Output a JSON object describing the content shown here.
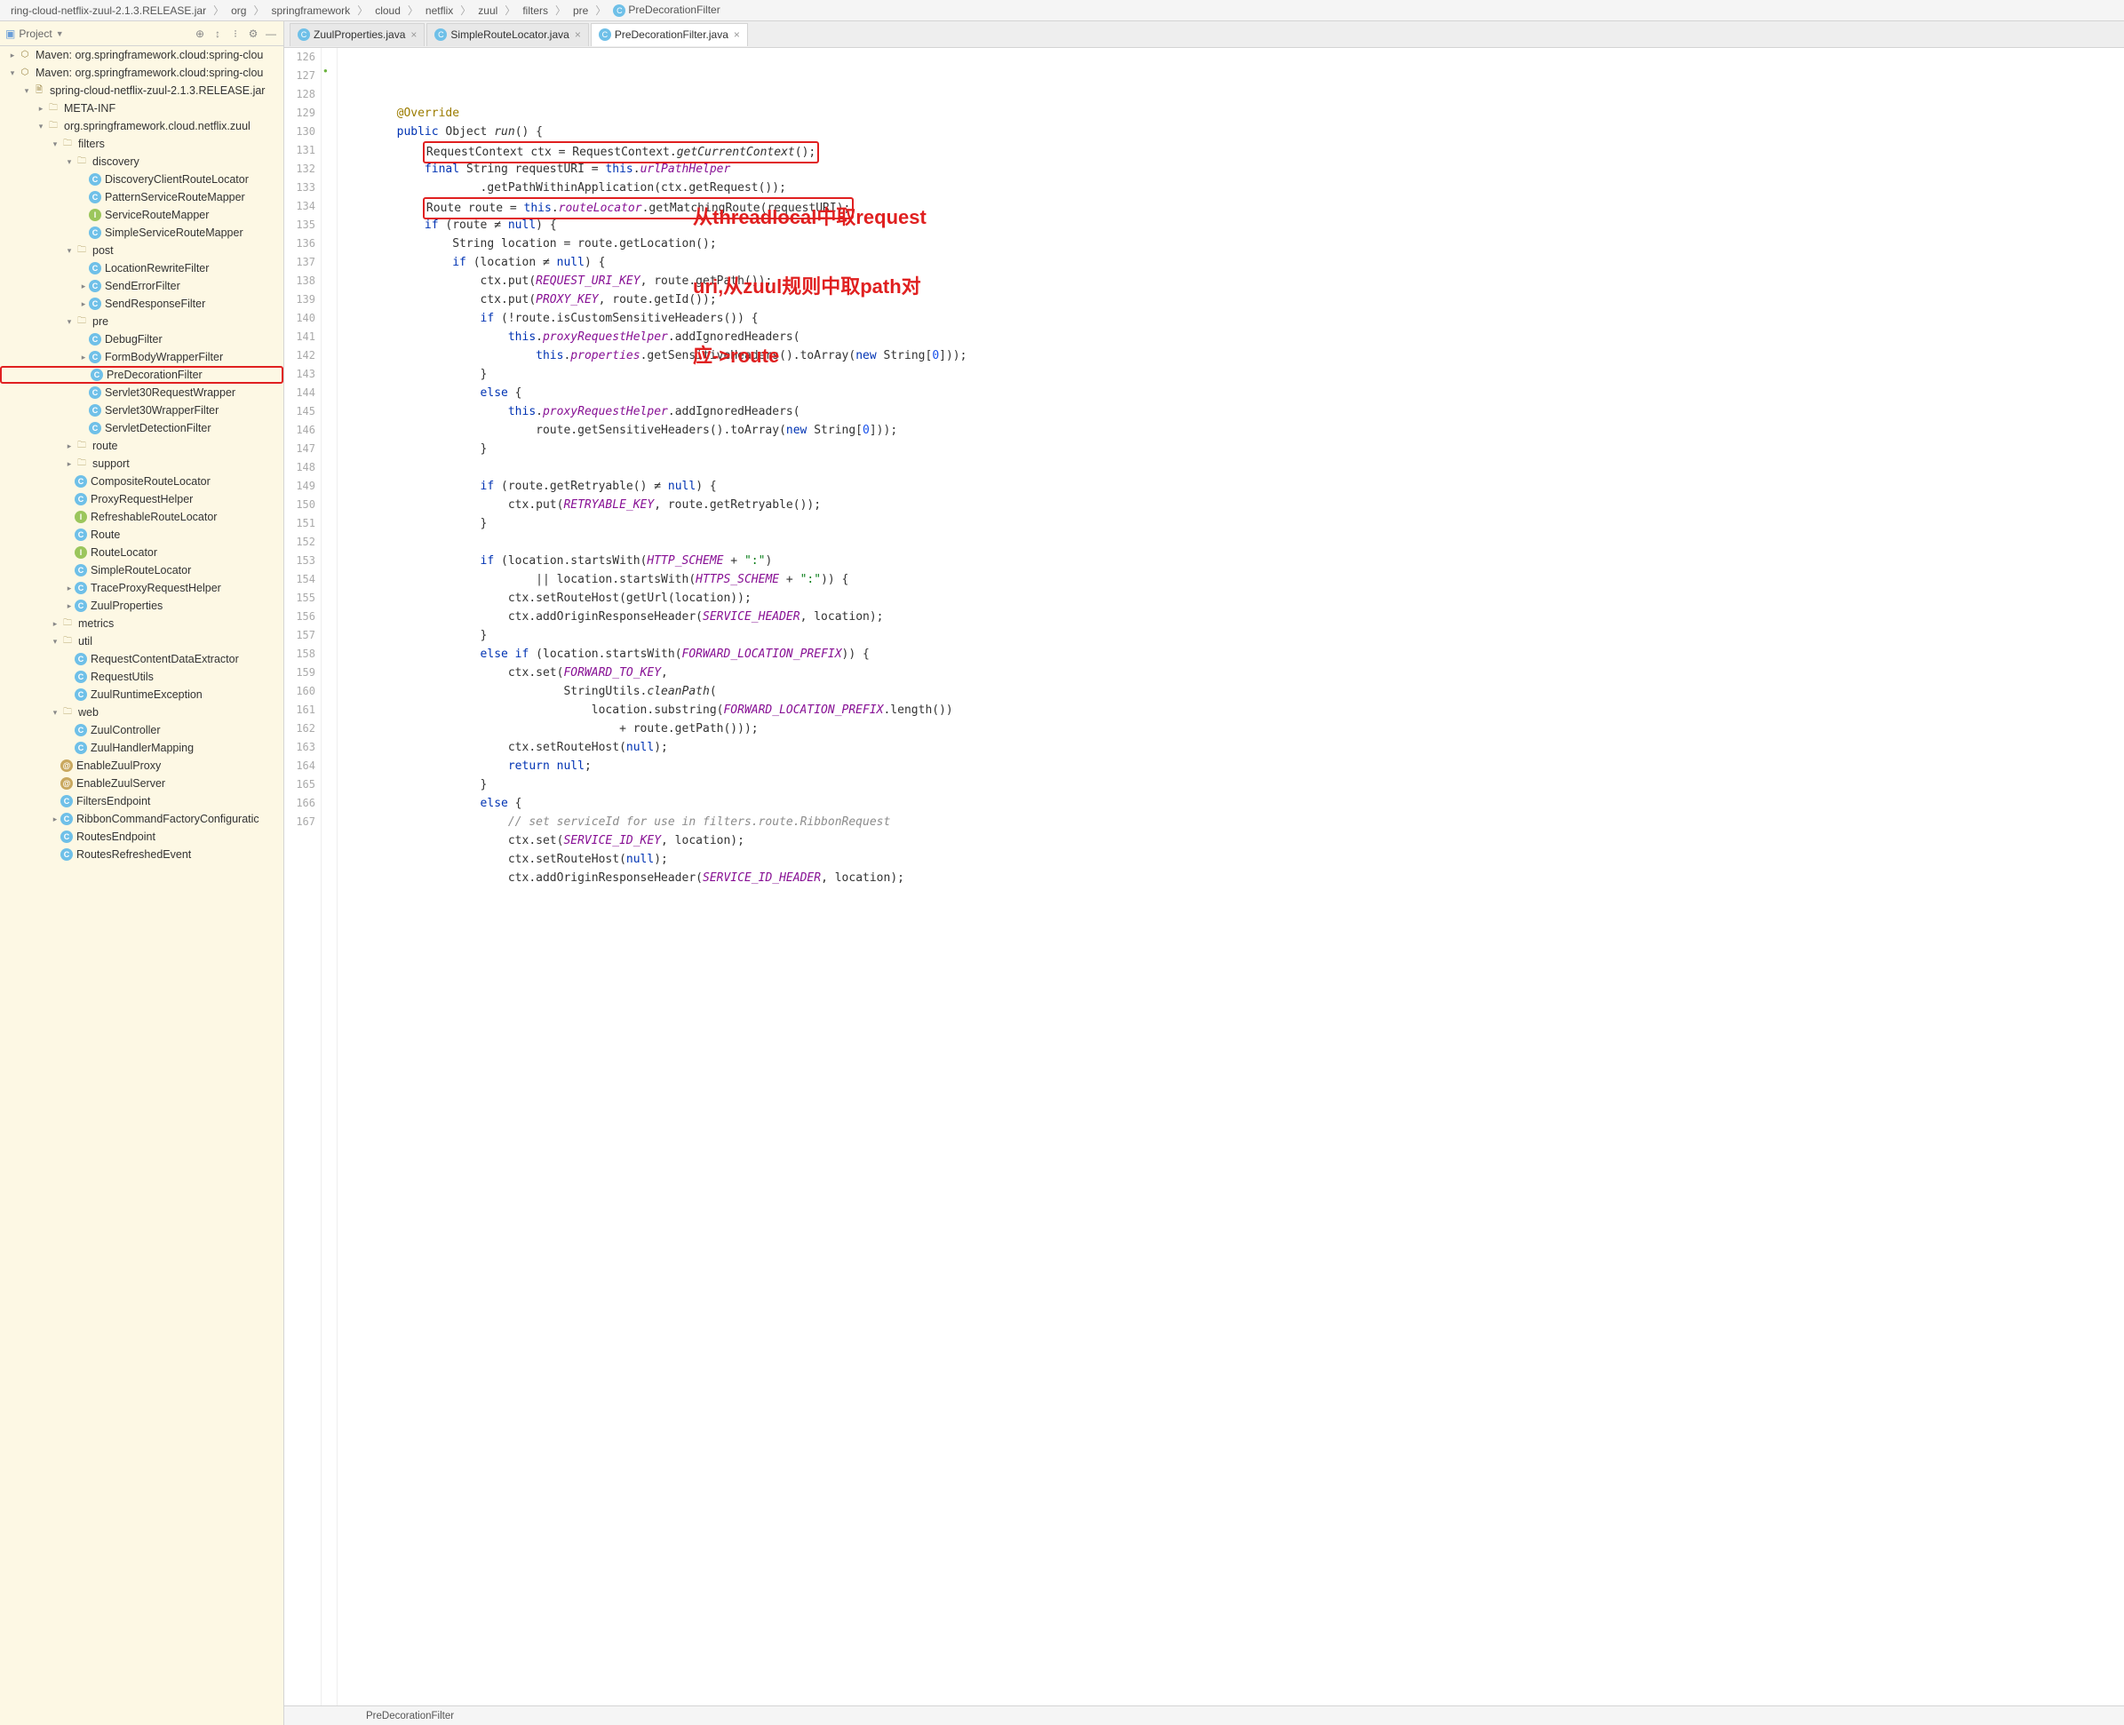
{
  "breadcrumb": [
    "ring-cloud-netflix-zuul-2.1.3.RELEASE.jar",
    "org",
    "springframework",
    "cloud",
    "netflix",
    "zuul",
    "filters",
    "pre",
    "PreDecorationFilter"
  ],
  "sidebar": {
    "title": "Project",
    "toolicons": [
      "target",
      "sort",
      "filter",
      "gear",
      "hide"
    ],
    "tree": [
      {
        "d": 0,
        "a": ">",
        "i": "mvn",
        "t": "Maven: org.springframework.cloud:spring-clou"
      },
      {
        "d": 0,
        "a": "v",
        "i": "mvn",
        "t": "Maven: org.springframework.cloud:spring-clou"
      },
      {
        "d": 1,
        "a": "v",
        "i": "jar",
        "t": "spring-cloud-netflix-zuul-2.1.3.RELEASE.jar"
      },
      {
        "d": 2,
        "a": ">",
        "i": "folder",
        "t": "META-INF"
      },
      {
        "d": 2,
        "a": "v",
        "i": "pkg",
        "t": "org.springframework.cloud.netflix.zuul"
      },
      {
        "d": 3,
        "a": "v",
        "i": "folder",
        "t": "filters"
      },
      {
        "d": 4,
        "a": "v",
        "i": "folder",
        "t": "discovery"
      },
      {
        "d": 5,
        "a": "",
        "i": "C",
        "t": "DiscoveryClientRouteLocator"
      },
      {
        "d": 5,
        "a": "",
        "i": "C",
        "t": "PatternServiceRouteMapper"
      },
      {
        "d": 5,
        "a": "",
        "i": "I",
        "t": "ServiceRouteMapper"
      },
      {
        "d": 5,
        "a": "",
        "i": "C",
        "t": "SimpleServiceRouteMapper"
      },
      {
        "d": 4,
        "a": "v",
        "i": "folder",
        "t": "post"
      },
      {
        "d": 5,
        "a": "",
        "i": "C",
        "t": "LocationRewriteFilter"
      },
      {
        "d": 5,
        "a": ">",
        "i": "C",
        "t": "SendErrorFilter"
      },
      {
        "d": 5,
        "a": ">",
        "i": "C",
        "t": "SendResponseFilter"
      },
      {
        "d": 4,
        "a": "v",
        "i": "folder",
        "t": "pre"
      },
      {
        "d": 5,
        "a": "",
        "i": "C",
        "t": "DebugFilter"
      },
      {
        "d": 5,
        "a": ">",
        "i": "C",
        "t": "FormBodyWrapperFilter"
      },
      {
        "d": 5,
        "a": "",
        "i": "C",
        "t": "PreDecorationFilter",
        "hl": true
      },
      {
        "d": 5,
        "a": "",
        "i": "C",
        "t": "Servlet30RequestWrapper"
      },
      {
        "d": 5,
        "a": "",
        "i": "C",
        "t": "Servlet30WrapperFilter"
      },
      {
        "d": 5,
        "a": "",
        "i": "C",
        "t": "ServletDetectionFilter"
      },
      {
        "d": 4,
        "a": ">",
        "i": "folder",
        "t": "route"
      },
      {
        "d": 4,
        "a": ">",
        "i": "folder",
        "t": "support"
      },
      {
        "d": 4,
        "a": "",
        "i": "C",
        "t": "CompositeRouteLocator"
      },
      {
        "d": 4,
        "a": "",
        "i": "C",
        "t": "ProxyRequestHelper"
      },
      {
        "d": 4,
        "a": "",
        "i": "I",
        "t": "RefreshableRouteLocator"
      },
      {
        "d": 4,
        "a": "",
        "i": "C",
        "t": "Route"
      },
      {
        "d": 4,
        "a": "",
        "i": "I",
        "t": "RouteLocator"
      },
      {
        "d": 4,
        "a": "",
        "i": "C",
        "t": "SimpleRouteLocator"
      },
      {
        "d": 4,
        "a": ">",
        "i": "C",
        "t": "TraceProxyRequestHelper"
      },
      {
        "d": 4,
        "a": ">",
        "i": "C",
        "t": "ZuulProperties"
      },
      {
        "d": 3,
        "a": ">",
        "i": "folder",
        "t": "metrics"
      },
      {
        "d": 3,
        "a": "v",
        "i": "folder",
        "t": "util"
      },
      {
        "d": 4,
        "a": "",
        "i": "C",
        "t": "RequestContentDataExtractor"
      },
      {
        "d": 4,
        "a": "",
        "i": "C",
        "t": "RequestUtils"
      },
      {
        "d": 4,
        "a": "",
        "i": "C",
        "t": "ZuulRuntimeException"
      },
      {
        "d": 3,
        "a": "v",
        "i": "folder",
        "t": "web"
      },
      {
        "d": 4,
        "a": "",
        "i": "C",
        "t": "ZuulController"
      },
      {
        "d": 4,
        "a": "",
        "i": "C",
        "t": "ZuulHandlerMapping"
      },
      {
        "d": 3,
        "a": "",
        "i": "@",
        "t": "EnableZuulProxy"
      },
      {
        "d": 3,
        "a": "",
        "i": "@",
        "t": "EnableZuulServer"
      },
      {
        "d": 3,
        "a": "",
        "i": "C",
        "t": "FiltersEndpoint"
      },
      {
        "d": 3,
        "a": ">",
        "i": "C",
        "t": "RibbonCommandFactoryConfiguratic"
      },
      {
        "d": 3,
        "a": "",
        "i": "C",
        "t": "RoutesEndpoint"
      },
      {
        "d": 3,
        "a": "",
        "i": "C",
        "t": "RoutesRefreshedEvent"
      }
    ]
  },
  "tabs": [
    {
      "label": "ZuulProperties.java",
      "active": false
    },
    {
      "label": "SimpleRouteLocator.java",
      "active": false
    },
    {
      "label": "PreDecorationFilter.java",
      "active": true
    }
  ],
  "gutter_start": 126,
  "gutter_end": 167,
  "code_lines": [
    {
      "n": 126,
      "html": "        <span class='ann'>@Override</span>"
    },
    {
      "n": 127,
      "html": "        <span class='kw'>public</span> Object <span class='mth'>run</span>() {",
      "mark": true
    },
    {
      "n": 128,
      "html": "            <span class='boxr'>RequestContext ctx = RequestContext.<span class='mth'>getCurrentContext</span>();</span>"
    },
    {
      "n": 129,
      "html": "            <span class='kw'>final</span> String requestURI = <span class='this'>this</span>.<span class='fld'>urlPathHelper</span>"
    },
    {
      "n": 130,
      "html": "                    .getPathWithinApplication(ctx.getRequest());"
    },
    {
      "n": 131,
      "html": "            <span class='boxr'>Route route = <span class='this'>this</span>.<span class='fld'>routeLocator</span>.getMatchingRoute(requestURI);</span>"
    },
    {
      "n": 132,
      "html": "            <span class='kw'>if</span> (route ≠ <span class='kw'>null</span>) {"
    },
    {
      "n": 133,
      "html": "                String location = route.getLocation();"
    },
    {
      "n": 134,
      "html": "                <span class='kw'>if</span> (location ≠ <span class='kw'>null</span>) {"
    },
    {
      "n": 135,
      "html": "                    ctx.put(<span class='con'>REQUEST_URI_KEY</span>, route.getPath());"
    },
    {
      "n": 136,
      "html": "                    ctx.put(<span class='con'>PROXY_KEY</span>, route.getId());"
    },
    {
      "n": 137,
      "html": "                    <span class='kw'>if</span> (!route.isCustomSensitiveHeaders()) {"
    },
    {
      "n": 138,
      "html": "                        <span class='this'>this</span>.<span class='fld'>proxyRequestHelper</span>.addIgnoredHeaders("
    },
    {
      "n": 139,
      "html": "                            <span class='this'>this</span>.<span class='fld'>properties</span>.getSensitiveHeaders().toArray(<span class='kw'>new</span> String[<span class='num'>0</span>]));"
    },
    {
      "n": 140,
      "html": "                    }"
    },
    {
      "n": 141,
      "html": "                    <span class='kw'>else</span> {"
    },
    {
      "n": 142,
      "html": "                        <span class='this'>this</span>.<span class='fld'>proxyRequestHelper</span>.addIgnoredHeaders("
    },
    {
      "n": 143,
      "html": "                            route.getSensitiveHeaders().toArray(<span class='kw'>new</span> String[<span class='num'>0</span>]));"
    },
    {
      "n": 144,
      "html": "                    }"
    },
    {
      "n": 145,
      "html": ""
    },
    {
      "n": 146,
      "html": "                    <span class='kw'>if</span> (route.getRetryable() ≠ <span class='kw'>null</span>) {"
    },
    {
      "n": 147,
      "html": "                        ctx.put(<span class='con'>RETRYABLE_KEY</span>, route.getRetryable());"
    },
    {
      "n": 148,
      "html": "                    }"
    },
    {
      "n": 149,
      "html": ""
    },
    {
      "n": 150,
      "html": "                    <span class='kw'>if</span> (location.startsWith(<span class='con'>HTTP_SCHEME</span> + <span class='str'>\":\"</span>)"
    },
    {
      "n": 151,
      "html": "                            || location.startsWith(<span class='con'>HTTPS_SCHEME</span> + <span class='str'>\":\"</span>)) {"
    },
    {
      "n": 152,
      "html": "                        ctx.setRouteHost(getUrl(location));"
    },
    {
      "n": 153,
      "html": "                        ctx.addOriginResponseHeader(<span class='con'>SERVICE_HEADER</span>, location);"
    },
    {
      "n": 154,
      "html": "                    }"
    },
    {
      "n": 155,
      "html": "                    <span class='kw'>else if</span> (location.startsWith(<span class='con'>FORWARD_LOCATION_PREFIX</span>)) {"
    },
    {
      "n": 156,
      "html": "                        ctx.set(<span class='con'>FORWARD_TO_KEY</span>,"
    },
    {
      "n": 157,
      "html": "                                StringUtils.<span class='mth'>cleanPath</span>("
    },
    {
      "n": 158,
      "html": "                                    location.substring(<span class='con'>FORWARD_LOCATION_PREFIX</span>.length())"
    },
    {
      "n": 159,
      "html": "                                        + route.getPath()));"
    },
    {
      "n": 160,
      "html": "                        ctx.setRouteHost(<span class='kw'>null</span>);"
    },
    {
      "n": 161,
      "html": "                        <span class='kw'>return null</span>;"
    },
    {
      "n": 162,
      "html": "                    }"
    },
    {
      "n": 163,
      "html": "                    <span class='kw'>else</span> {"
    },
    {
      "n": 164,
      "html": "                        <span class='cmt'>// set serviceId for use in filters.route.RibbonRequest</span>"
    },
    {
      "n": 165,
      "html": "                        ctx.set(<span class='con'>SERVICE_ID_KEY</span>, location);"
    },
    {
      "n": 166,
      "html": "                        ctx.setRouteHost(<span class='kw'>null</span>);"
    },
    {
      "n": 167,
      "html": "                        ctx.addOriginResponseHeader(<span class='con'>SERVICE_ID_HEADER</span>, location);"
    }
  ],
  "annotation": {
    "line1": "从threadlocal中取request",
    "line2": "uri,从zuul规则中取path对",
    "line3": "应->route"
  },
  "statusbar": {
    "context": "PreDecorationFilter"
  }
}
